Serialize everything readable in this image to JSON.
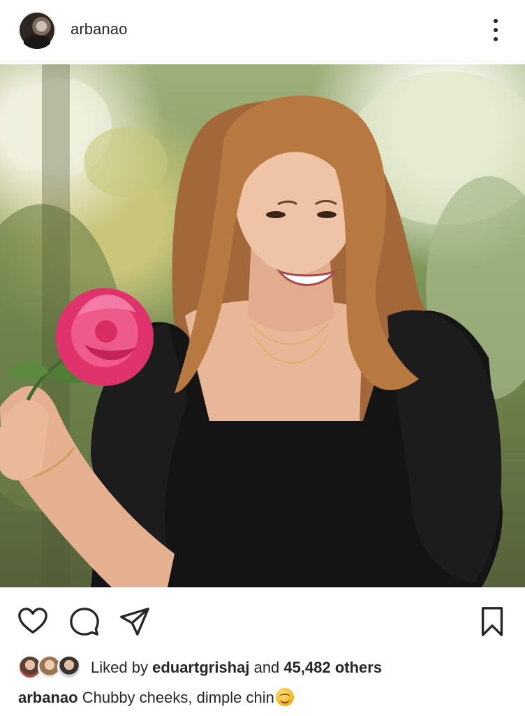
{
  "header": {
    "username": "arbanao",
    "avatar_icon": "profile-avatar",
    "more_icon": "more-vertical-icon"
  },
  "post": {
    "image_alt": "Photo",
    "colors": {
      "dress": "#121212",
      "rose": "#e0336b",
      "foliage": "#7f9a5d"
    }
  },
  "actions": {
    "like_icon": "heart-icon",
    "comment_icon": "comment-icon",
    "share_icon": "send-icon",
    "save_icon": "bookmark-icon"
  },
  "likes": {
    "prefix": "Liked by",
    "user": "eduartgrishaj",
    "conjunction": "and",
    "count": "45,482 others"
  },
  "caption": {
    "username": "arbanao",
    "text": "Chubby cheeks, dimple chin"
  }
}
